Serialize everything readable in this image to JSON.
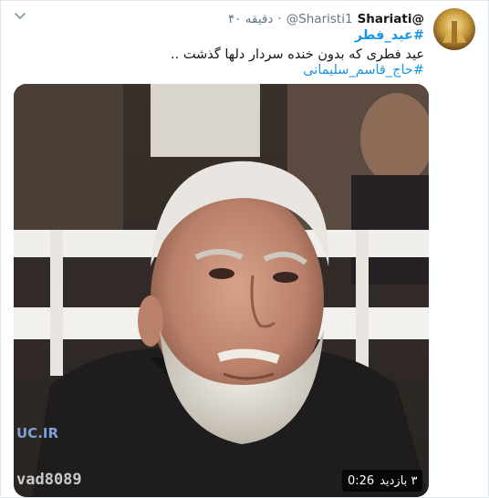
{
  "tweet": {
    "display_name": "Shariati@",
    "handle": "@Sharisti1",
    "separator": "·",
    "time": "۴۰ دقیقه",
    "hashtag_top": "#عید_فطر",
    "text": "عید فطری که بدون خنده سردار دلها گذشت ..",
    "hashtag_bottom": "#حاج_قاسم_سلیمانی",
    "menu_icon": "chevron-down-icon"
  },
  "media": {
    "watermark_logo": "UC.IR",
    "watermark_text": "vad8089",
    "duration": "0:26",
    "views": "۳ بازدید",
    "view_icon": "eye-icon"
  },
  "colors": {
    "link": "#1b95e0",
    "muted": "#657786",
    "text": "#14171a",
    "border": "#e1e8ed"
  }
}
